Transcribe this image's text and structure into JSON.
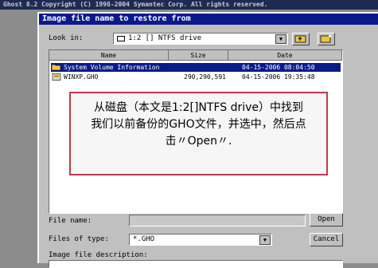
{
  "app_title": "Ghost 8.2   Copyright (C) 1998-2004 Symantec Corp. All rights reserved.",
  "dialog": {
    "title": "Image file name to restore from",
    "look_in_label": "Look in:",
    "look_in_value": "1:2 [] NTFS drive",
    "columns": {
      "name": "Name",
      "size": "Size",
      "date": "Date"
    },
    "files": [
      {
        "name": "System Volume Information",
        "size": "",
        "date": "04-15-2006 08:04:50",
        "type": "folder",
        "selected": true
      },
      {
        "name": "WINXP.GHO",
        "size": "290,290,591",
        "date": "04-15-2006 19:35:48",
        "type": "file",
        "selected": false
      }
    ],
    "file_name_label": "File name:",
    "file_name_value": "",
    "files_of_type_label": "Files of type:",
    "files_of_type_value": "*.GHO",
    "description_label": "Image file description:",
    "open_button": "Open",
    "cancel_button": "Cancel"
  },
  "callout": {
    "line1": "从磁盘（本文是1:2[]NTFS drive）中找到",
    "line2": "我们以前备份的GHO文件，并选中，然后点",
    "line3": "击〃Open〃."
  },
  "colors": {
    "title_bar": "#0a1a8a",
    "callout_border": "#c23a4a",
    "selection": "#0a1a8a"
  }
}
